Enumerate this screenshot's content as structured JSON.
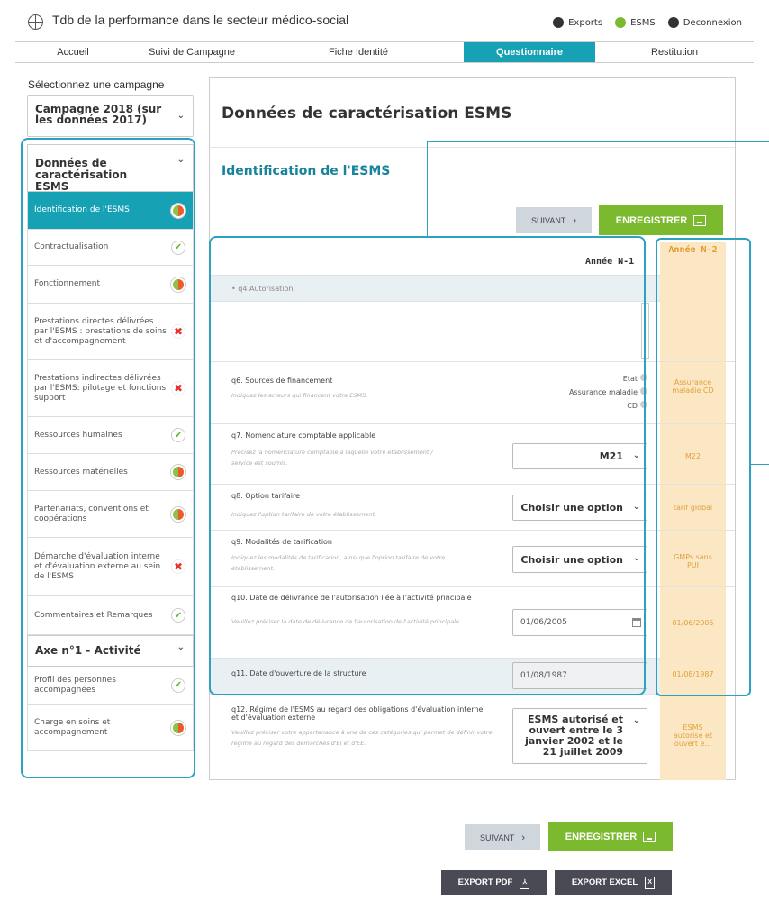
{
  "header": {
    "app_title": "Tdb de la performance dans le secteur médico-social",
    "links": [
      {
        "label": "Exports",
        "icon": "user-circle-icon",
        "color": "#333333"
      },
      {
        "label": "ESMS",
        "icon": "users-icon",
        "color": "#7bba2e"
      },
      {
        "label": "Deconnexion",
        "icon": "logout-icon",
        "color": "#333333"
      }
    ]
  },
  "nav": {
    "tabs": [
      {
        "label": "Accueil"
      },
      {
        "label": "Suivi de Campagne"
      },
      {
        "label": "Fiche Identité"
      },
      {
        "label": "Questionnaire",
        "active": true
      },
      {
        "label": "Restitution"
      }
    ]
  },
  "sidebar": {
    "title": "Sélectionnez une campagne",
    "campaign": "Campagne 2018 (sur les données 2017)",
    "groups": [
      {
        "label": "Données de caractérisation ESMS",
        "items": [
          {
            "label": "Identification de l'ESMS",
            "status": "partial",
            "active": true
          },
          {
            "label": "Contractualisation",
            "status": "ok"
          },
          {
            "label": "Fonctionnement",
            "status": "partial"
          },
          {
            "label": "Prestations directes délivrées par l'ESMS : prestations de soins et d'accompagnement",
            "status": "ko"
          },
          {
            "label": "Prestations indirectes délivrées par l'ESMS: pilotage et fonctions support",
            "status": "ko"
          },
          {
            "label": "Ressources humaines",
            "status": "ok"
          },
          {
            "label": "Ressources matérielles",
            "status": "partial"
          },
          {
            "label": "Partenariats, conventions et coopérations",
            "status": "partial"
          },
          {
            "label": "Démarche d'évaluation interne et d'évaluation externe au sein de l'ESMS",
            "status": "ko"
          },
          {
            "label": "Commentaires et Remarques",
            "status": "ok"
          }
        ]
      },
      {
        "label": "Axe n°1 - Activité",
        "items": [
          {
            "label": "Profil des personnes accompagnées",
            "status": "ok"
          },
          {
            "label": "Charge en soins et accompagnement",
            "status": "partial"
          }
        ]
      }
    ]
  },
  "main": {
    "page_title": "Données de caractérisation ESMS",
    "section_title": "Identification de l'ESMS",
    "next_label": "SUIVANT",
    "save_label": "ENREGISTRER",
    "col_n1": "Année N-1",
    "col_n2": "Année N-2",
    "q4": "• q4 Autorisation",
    "q6": {
      "title": "q6. Sources de financement",
      "help": "Indiquez les acteurs qui financent votre ESMS.",
      "options": [
        "Etat",
        "Assurance maladie",
        "CD"
      ],
      "n2": "Assurance maladie CD"
    },
    "q7": {
      "title": "q7. Nomenclature comptable applicable",
      "help": "Précisez la nomenclature comptable à laquelle votre établissement / service est soumis.",
      "value": "M21",
      "n2": "M22"
    },
    "q8": {
      "title": "q8. Option tarifaire",
      "help": "Indiquez l'option tarifaire de votre établissement.",
      "value": "Choisir une option",
      "n2": "tarif global"
    },
    "q9": {
      "title": "q9. Modalités de tarification",
      "help": "Indiquez les modalités de tarification, ainsi que l'option tarifaire de votre établissement.",
      "value": "Choisir une option",
      "n2": "GMPs sans PUI"
    },
    "q10": {
      "title": "q10. Date de délivrance de l'autorisation liée à l'activité principale",
      "help": "Veuillez préciser la date de délivrance de l'autorisation de l'activité principale.",
      "value": "01/06/2005",
      "n2": "01/06/2005"
    },
    "q11": {
      "title": "q11. Date d'ouverture de la structure",
      "value": "01/08/1987",
      "n2": "01/08/1987"
    },
    "q12": {
      "title": "q12. Régime de l'ESMS au regard des obligations d'évaluation interne et d'évaluation externe",
      "help": "Veuillez préciser votre appartenance à une de ces catégories qui permet de définir votre régime au regard des démarches d'EI et d'EE.",
      "value": "ESMS autorisé et ouvert entre le 3 janvier 2002 et le 21 juillet 2009",
      "n2": "ESMS autorisé et ouvert e..."
    }
  },
  "footer": {
    "next_label": "SUIVANT",
    "save_label": "ENREGISTRER",
    "export_pdf": "EXPORT PDF",
    "export_excel": "EXPORT EXCEL"
  },
  "colors": {
    "accent": "#17a1b5",
    "save_green": "#7bba2e",
    "n2_background": "#fbe7c4",
    "n2_text": "#e39a2a",
    "callout": "#2ba3c0",
    "status_ok": "#5cb82e",
    "status_ko": "#e63232"
  }
}
